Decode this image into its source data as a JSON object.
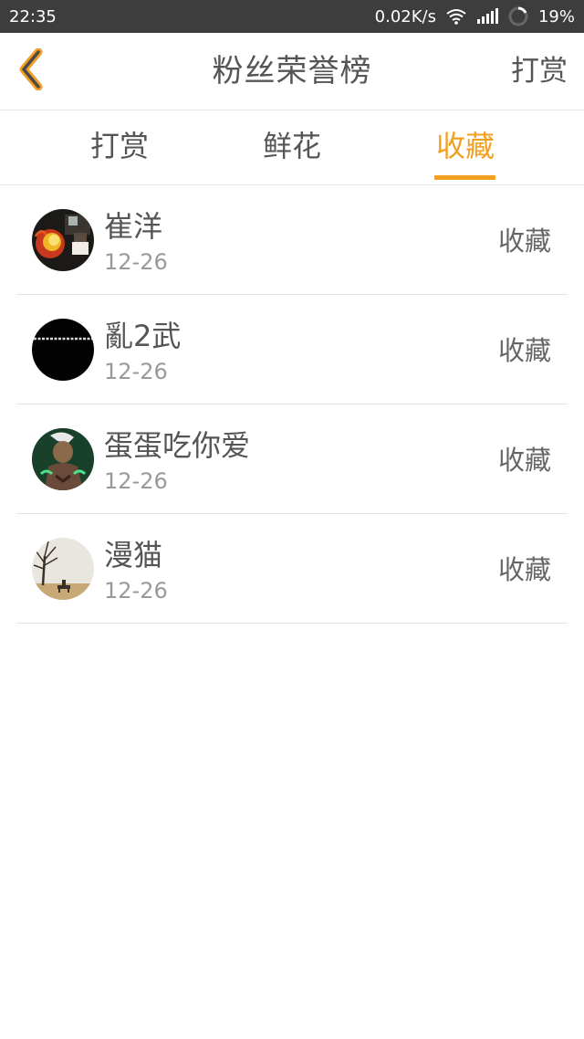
{
  "status_bar": {
    "time": "22:35",
    "network_speed": "0.02K/s",
    "battery": "19%"
  },
  "header": {
    "title": "粉丝荣誉榜",
    "action_label": "打赏",
    "back_icon": "chevron-left-icon",
    "accent_color": "#f3a021"
  },
  "tabs": [
    {
      "label": "打赏",
      "active": false
    },
    {
      "label": "鲜花",
      "active": false
    },
    {
      "label": "收藏",
      "active": true
    }
  ],
  "list": [
    {
      "name": "崔洋",
      "date": "12-26",
      "action": "收藏",
      "avatar_icon": "avatar-fire-icon"
    },
    {
      "name": "亂2武",
      "date": "12-26",
      "action": "收藏",
      "avatar_icon": "avatar-black-text-icon"
    },
    {
      "name": "蛋蛋吃你爱",
      "date": "12-26",
      "action": "收藏",
      "avatar_icon": "avatar-character-icon"
    },
    {
      "name": "漫猫",
      "date": "12-26",
      "action": "收藏",
      "avatar_icon": "avatar-tree-bench-icon"
    }
  ]
}
